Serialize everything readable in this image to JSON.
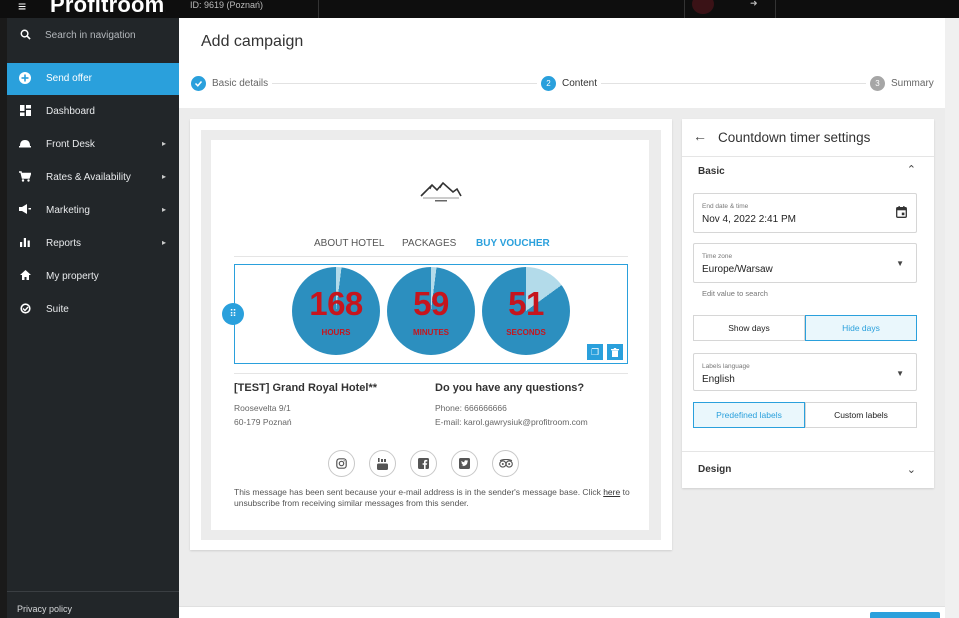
{
  "app": {
    "brand": "Profitroom",
    "hotel_id": "ID: 9619  (Poznań)"
  },
  "sidebar": {
    "search_placeholder": "Search in navigation",
    "items": [
      {
        "label": "Send offer",
        "icon": "plus-circle-icon",
        "active": true
      },
      {
        "label": "Dashboard",
        "icon": "dashboard-icon"
      },
      {
        "label": "Front Desk",
        "icon": "bell-icon",
        "has_submenu": true
      },
      {
        "label": "Rates & Availability",
        "icon": "cart-icon",
        "has_submenu": true
      },
      {
        "label": "Marketing",
        "icon": "megaphone-icon",
        "has_submenu": true
      },
      {
        "label": "Reports",
        "icon": "bar-chart-icon",
        "has_submenu": true
      },
      {
        "label": "My property",
        "icon": "home-icon"
      },
      {
        "label": "Suite",
        "icon": "suite-icon"
      }
    ],
    "privacy": "Privacy policy"
  },
  "header": {
    "title": "Add campaign",
    "steps": [
      {
        "num": "",
        "label": "Basic details",
        "state": "done"
      },
      {
        "num": "2",
        "label": "Content",
        "state": "current"
      },
      {
        "num": "3",
        "label": "Summary",
        "state": "pending"
      }
    ]
  },
  "email": {
    "menu": [
      "ABOUT HOTEL",
      "PACKAGES",
      "BUY VOUCHER"
    ],
    "timer": [
      {
        "value": "168",
        "label": "HOURS",
        "progress": 0.02
      },
      {
        "value": "59",
        "label": "MINUTES",
        "progress": 0.02
      },
      {
        "value": "51",
        "label": "SECONDS",
        "progress": 0.15
      }
    ],
    "hotel_name": "[TEST] Grand Royal Hotel**",
    "street": "Roosevelta 9/1",
    "city": "60-179 Poznań",
    "questions_heading": "Do you have any questions?",
    "phone": "Phone: 666666666",
    "email": "E-mail: karol.gawrysiuk@profitroom.com",
    "social": [
      "instagram-icon",
      "youtube-icon",
      "facebook-icon",
      "twitter-icon",
      "tripadvisor-icon"
    ],
    "footer_before": "This message has been sent because your e-mail address is in the sender's message base. Click ",
    "footer_link": "here",
    "footer_after": " to unsubscribe from receiving similar messages from this sender."
  },
  "settings": {
    "title": "Countdown timer settings",
    "basic_label": "Basic",
    "end_date_label": "End date & time",
    "end_date_value": "Nov 4, 2022 2:41 PM",
    "timezone_label": "Time zone",
    "timezone_value": "Europe/Warsaw",
    "timezone_help": "Edit value to search",
    "show_days": "Show days",
    "hide_days": "Hide days",
    "labels_language_label": "Labels language",
    "labels_language_value": "English",
    "predefined_labels": "Predefined labels",
    "custom_labels": "Custom labels",
    "design_label": "Design"
  },
  "colors": {
    "accent": "#2aa0dc",
    "timer_circle": "#2c8fbf",
    "timer_text": "#c6151e",
    "sidebar_bg": "#222629"
  }
}
